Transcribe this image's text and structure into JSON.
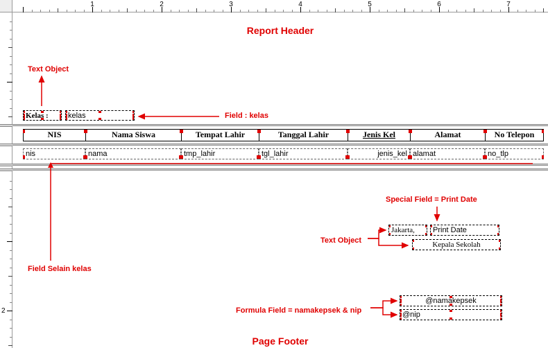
{
  "ruler": {
    "major_labels": [
      "1",
      "2",
      "3",
      "4",
      "5",
      "6",
      "7"
    ],
    "v_label": "2"
  },
  "header": {
    "title": "Report Header"
  },
  "group": {
    "text_object_label": "Text Object",
    "kelas_label": "Kelas :",
    "kelas_field": "kelas",
    "field_anno": "Field : kelas"
  },
  "columns": {
    "nis": "NIS",
    "nama": "Nama Siswa",
    "tmp": "Tempat Lahir",
    "tgl": "Tanggal Lahir",
    "jk": "Jenis Kel",
    "alamat": "Alamat",
    "tlp": "No Telepon"
  },
  "detail": {
    "nis": "nis",
    "nama": "nama",
    "tmp": "tmp_lahir",
    "tgl": "tgl_lahir",
    "jk": "jenis_kel",
    "alamat": "alamat",
    "tlp": "no_tlp",
    "anno": "Field Selain kelas"
  },
  "footer": {
    "special_anno": "Special Field = Print Date",
    "text_object_anno": "Text Object",
    "jakarta": "Jakarta,",
    "printdate": "Print Date",
    "kepsek": "Kepala Sekolah",
    "formula_anno": "Formula Field = namakepsek & nip",
    "namakepsek": "@namakepsek",
    "nip": "@nip",
    "title": "Page Footer"
  }
}
